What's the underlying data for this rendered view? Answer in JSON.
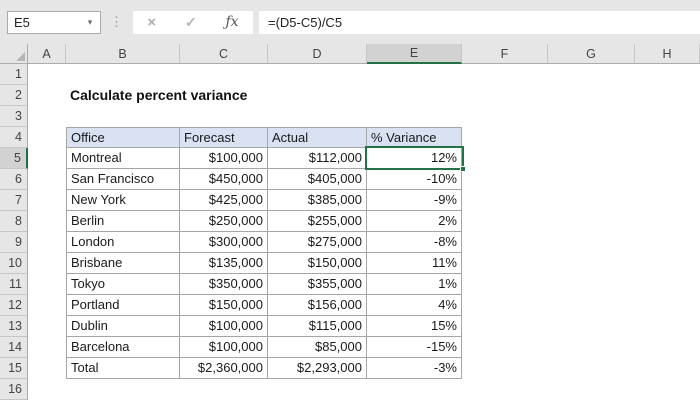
{
  "formula_bar": {
    "name_box": "E5",
    "formula": "=(D5-C5)/C5",
    "cancel_icon": "×",
    "enter_icon": "✓",
    "fx_label": "ƒx",
    "name_box_arrow": "▾",
    "separator_dots": "⋮"
  },
  "grid": {
    "column_headers": [
      "A",
      "B",
      "C",
      "D",
      "E",
      "F",
      "G",
      "H"
    ],
    "row_headers": [
      1,
      2,
      3,
      4,
      5,
      6,
      7,
      8,
      9,
      10,
      11,
      12,
      13,
      14,
      15,
      16
    ],
    "selected_cell": "E5",
    "selected_column": "E",
    "selected_row": 5
  },
  "sheet": {
    "title": "Calculate percent variance",
    "table": {
      "range": "B4:E15",
      "headers": [
        "Office",
        "Forecast",
        "Actual",
        "% Variance"
      ],
      "rows": [
        [
          "Montreal",
          "$100,000",
          "$112,000",
          "12%"
        ],
        [
          "San Francisco",
          "$450,000",
          "$405,000",
          "-10%"
        ],
        [
          "New York",
          "$425,000",
          "$385,000",
          "-9%"
        ],
        [
          "Berlin",
          "$250,000",
          "$255,000",
          "2%"
        ],
        [
          "London",
          "$300,000",
          "$275,000",
          "-8%"
        ],
        [
          "Brisbane",
          "$135,000",
          "$150,000",
          "11%"
        ],
        [
          "Tokyo",
          "$350,000",
          "$355,000",
          "1%"
        ],
        [
          "Portland",
          "$150,000",
          "$156,000",
          "4%"
        ],
        [
          "Dublin",
          "$100,000",
          "$115,000",
          "15%"
        ],
        [
          "Barcelona",
          "$100,000",
          "$85,000",
          "-15%"
        ],
        [
          "Total",
          "$2,360,000",
          "$2,293,000",
          "-3%"
        ]
      ]
    }
  },
  "colors": {
    "accent_green": "#217346",
    "chrome_bg": "#E6E6E6",
    "table_header_fill": "#D9E1F2",
    "table_border": "#A6A6A6",
    "selected_header_bg": "#D2D2D2"
  }
}
